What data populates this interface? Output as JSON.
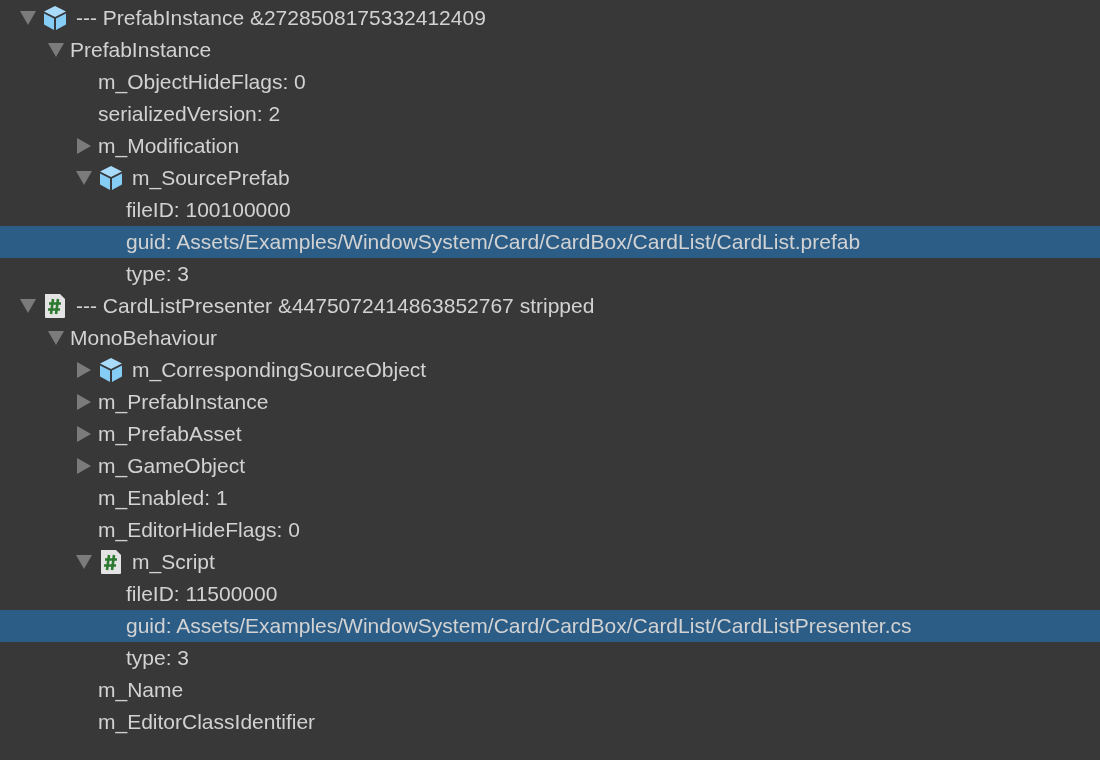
{
  "tree": [
    {
      "label": "--- PrefabInstance &2728508175332412409",
      "kind": "prefab",
      "expanded": true,
      "selected": false,
      "children": [
        {
          "label": "PrefabInstance",
          "expanded": true,
          "selected": false,
          "children": [
            {
              "label": "m_ObjectHideFlags: 0",
              "selected": false
            },
            {
              "label": "serializedVersion: 2",
              "selected": false
            },
            {
              "label": "m_Modification",
              "expanded": false,
              "selected": false
            },
            {
              "label": "m_SourcePrefab",
              "kind": "prefab",
              "expanded": true,
              "selected": false,
              "children": [
                {
                  "label": "fileID: 100100000",
                  "selected": false
                },
                {
                  "label": "guid: Assets/Examples/WindowSystem/Card/CardBox/CardList/CardList.prefab",
                  "selected": true
                },
                {
                  "label": "type: 3",
                  "selected": false
                }
              ]
            }
          ]
        }
      ]
    },
    {
      "label": "--- CardListPresenter &4475072414863852767 stripped",
      "kind": "script",
      "expanded": true,
      "selected": false,
      "children": [
        {
          "label": "MonoBehaviour",
          "expanded": true,
          "selected": false,
          "children": [
            {
              "label": "m_CorrespondingSourceObject",
              "kind": "prefab",
              "expanded": false,
              "selected": false
            },
            {
              "label": "m_PrefabInstance",
              "expanded": false,
              "selected": false
            },
            {
              "label": "m_PrefabAsset",
              "expanded": false,
              "selected": false
            },
            {
              "label": "m_GameObject",
              "expanded": false,
              "selected": false
            },
            {
              "label": "m_Enabled: 1",
              "selected": false
            },
            {
              "label": "m_EditorHideFlags: 0",
              "selected": false
            },
            {
              "label": "m_Script",
              "kind": "script",
              "expanded": true,
              "selected": false,
              "children": [
                {
                  "label": "fileID: 11500000",
                  "selected": false
                },
                {
                  "label": "guid: Assets/Examples/WindowSystem/Card/CardBox/CardList/CardListPresenter.cs",
                  "selected": true
                },
                {
                  "label": "type: 3",
                  "selected": false
                }
              ]
            },
            {
              "label": "m_Name",
              "selected": false
            },
            {
              "label": "m_EditorClassIdentifier",
              "selected": false
            }
          ]
        }
      ]
    }
  ]
}
